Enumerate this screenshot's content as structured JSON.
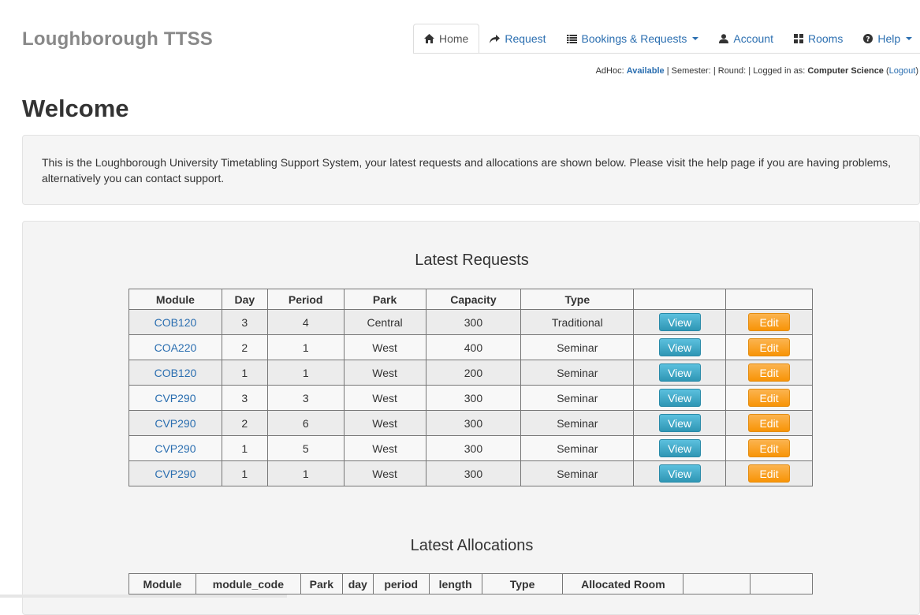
{
  "app": {
    "brand": "Loughborough TTSS"
  },
  "nav": {
    "items": [
      {
        "label": "Home",
        "icon": "home-icon",
        "active": true
      },
      {
        "label": "Request",
        "icon": "share-arrow-icon"
      },
      {
        "label": "Bookings & Requests",
        "icon": "list-icon",
        "dropdown": true
      },
      {
        "label": "Account",
        "icon": "user-icon"
      },
      {
        "label": "Rooms",
        "icon": "grid-icon"
      },
      {
        "label": "Help",
        "icon": "question-circle-icon",
        "dropdown": true
      }
    ]
  },
  "status": {
    "adhoc_label": "AdHoc:",
    "adhoc_value": "Available",
    "semester_label": "Semester:",
    "round_label": "Round:",
    "logged_label": "Logged in as:",
    "user": "Computer Science",
    "logout": "Logout"
  },
  "page": {
    "title": "Welcome",
    "intro": "This is the Loughborough University Timetabling Support System, your latest requests and allocations are shown below. Please visit the help page if you are having problems, alternatively you can contact support."
  },
  "requests": {
    "title": "Latest Requests",
    "columns": [
      "Module",
      "Day",
      "Period",
      "Park",
      "Capacity",
      "Type",
      "",
      ""
    ],
    "view_label": "View",
    "edit_label": "Edit",
    "rows": [
      [
        "COB120",
        "3",
        "4",
        "Central",
        "300",
        "Traditional"
      ],
      [
        "COA220",
        "2",
        "1",
        "West",
        "400",
        "Seminar"
      ],
      [
        "COB120",
        "1",
        "1",
        "West",
        "200",
        "Seminar"
      ],
      [
        "CVP290",
        "3",
        "3",
        "West",
        "300",
        "Seminar"
      ],
      [
        "CVP290",
        "2",
        "6",
        "West",
        "300",
        "Seminar"
      ],
      [
        "CVP290",
        "1",
        "5",
        "West",
        "300",
        "Seminar"
      ],
      [
        "CVP290",
        "1",
        "1",
        "West",
        "300",
        "Seminar"
      ]
    ]
  },
  "allocations": {
    "title": "Latest Allocations",
    "columns": [
      "Module",
      "module_code",
      "Park",
      "day",
      "period",
      "length",
      "Type",
      "Allocated Room",
      "",
      ""
    ]
  },
  "colors": {
    "link": "#2a6eb0",
    "view_button": "#5bc0de",
    "edit_button": "#f89406",
    "brand": "#888888"
  }
}
